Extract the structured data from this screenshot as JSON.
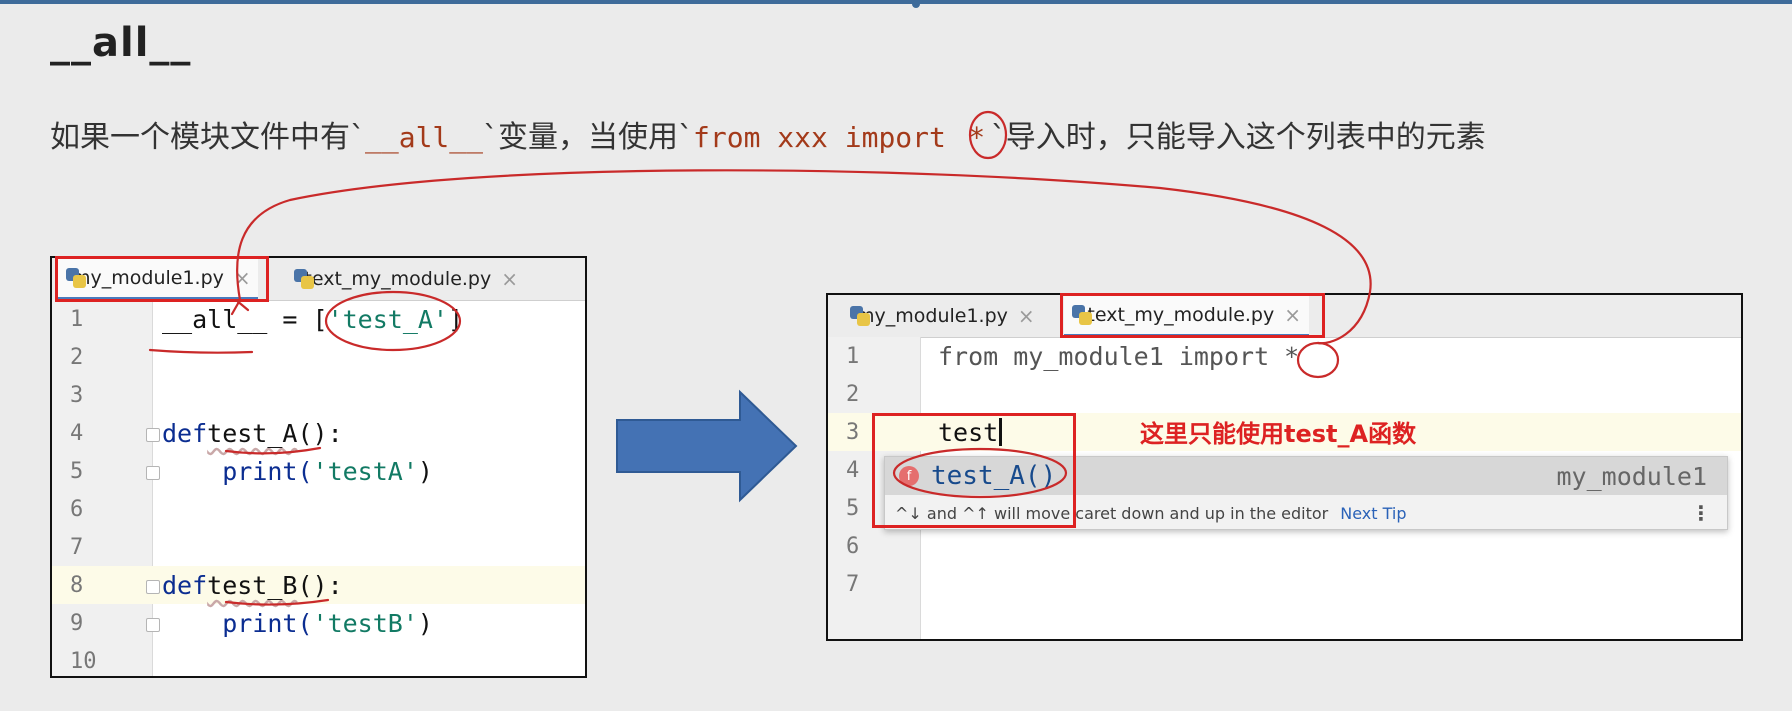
{
  "heading": "__all__",
  "description": {
    "prefix": "如果一个模块文件中有`",
    "var": "__all__",
    "middle": "`变量，当使用`",
    "code": "from xxx import ",
    "star": "*",
    "suffix": "`导入时，只能导入这个列表中的元素"
  },
  "left_editor": {
    "tabs": [
      {
        "label": "my_module1.py",
        "active": true
      },
      {
        "label": "text_my_module.py",
        "active": false
      }
    ],
    "lines": [
      {
        "num": "1",
        "text": "__all__ = ['test_A']"
      },
      {
        "num": "2",
        "text": ""
      },
      {
        "num": "3",
        "text": ""
      },
      {
        "num": "4",
        "kw": "def ",
        "name": "test_A",
        "rest": "():"
      },
      {
        "num": "5",
        "indent": "    ",
        "call": "print(",
        "str": "'testA'",
        "close": ")"
      },
      {
        "num": "6",
        "text": ""
      },
      {
        "num": "7",
        "text": ""
      },
      {
        "num": "8",
        "kw": "def ",
        "name": "test_B",
        "rest": "():"
      },
      {
        "num": "9",
        "indent": "    ",
        "call": "print(",
        "str": "'testB'",
        "close": ")"
      },
      {
        "num": "10",
        "text": ""
      }
    ],
    "line1": {
      "pre": "__all__ = [",
      "str": "'test_A'",
      "post": "]"
    }
  },
  "right_editor": {
    "tabs": [
      {
        "label": "my_module1.py",
        "active": false
      },
      {
        "label": "text_my_module.py",
        "active": true
      }
    ],
    "lines": [
      {
        "num": "1",
        "text": "from my_module1 import *"
      },
      {
        "num": "2",
        "text": ""
      },
      {
        "num": "3",
        "text": "test"
      },
      {
        "num": "4",
        "text": ""
      },
      {
        "num": "5",
        "text": ""
      },
      {
        "num": "6",
        "text": ""
      },
      {
        "num": "7",
        "text": ""
      }
    ],
    "autocomplete": {
      "icon_letter": "f",
      "suggestion": "test_A()",
      "module": "my_module1",
      "tip": "^↓ and ^↑ will move caret down and up in the editor",
      "tip_link": "Next Tip",
      "menu": "⋮"
    },
    "annotation": "这里只能使用test_A函数"
  },
  "colors": {
    "accent_red": "#dd2222",
    "arrow_blue": "#4472b4",
    "keyword": "#0b2d91",
    "string": "#127a64"
  }
}
